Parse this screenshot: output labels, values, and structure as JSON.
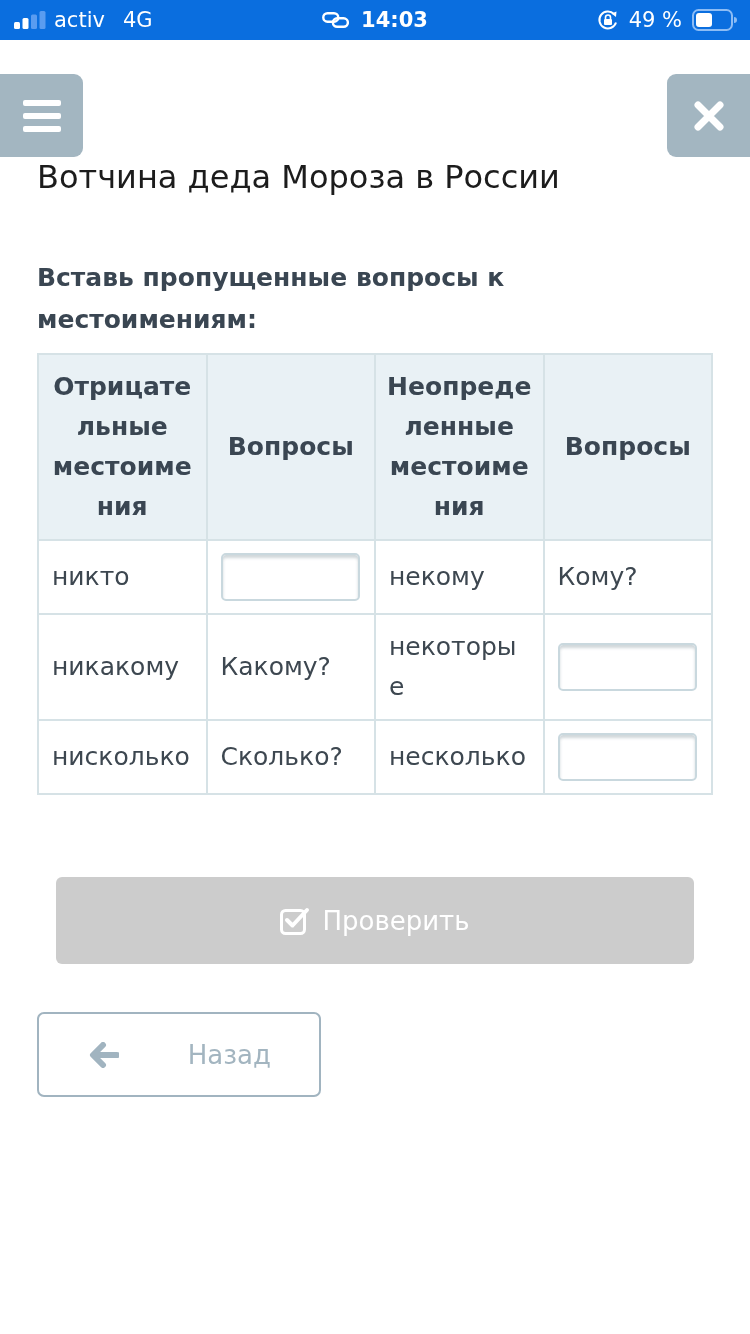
{
  "status_bar": {
    "carrier": "activ",
    "network": "4G",
    "time": "14:03",
    "battery": "49 %"
  },
  "title": "Вотчина деда Мороза в России",
  "instruction": "Вставь пропущенные вопросы к местоимениям:",
  "table": {
    "columns": [
      "Отрицательные местоимения",
      "Вопросы",
      "Неопределенные местоимения",
      "Вопросы"
    ],
    "rows": [
      [
        {
          "kind": "text",
          "text": "никто"
        },
        {
          "kind": "input"
        },
        {
          "kind": "text",
          "text": "некому"
        },
        {
          "kind": "text",
          "text": "Кому?"
        }
      ],
      [
        {
          "kind": "text",
          "text": "никакому"
        },
        {
          "kind": "text",
          "text": "Какому?"
        },
        {
          "kind": "text",
          "text": "некоторые"
        },
        {
          "kind": "input"
        }
      ],
      [
        {
          "kind": "text",
          "text": "нисколько"
        },
        {
          "kind": "text",
          "text": "Сколько?"
        },
        {
          "kind": "text",
          "text": "несколько"
        },
        {
          "kind": "input"
        }
      ]
    ]
  },
  "check_button": {
    "label": "Проверить",
    "disabled": true
  },
  "back_button": {
    "label": "Назад"
  }
}
